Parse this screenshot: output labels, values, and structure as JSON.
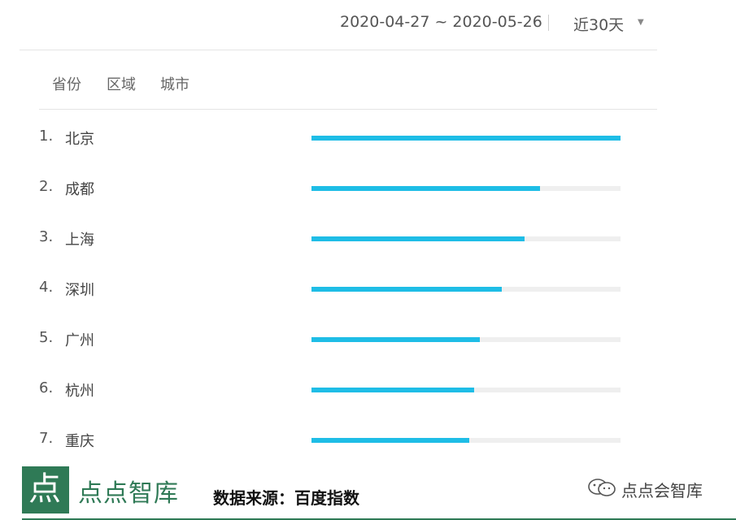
{
  "header": {
    "date_range": "2020-04-27 ~ 2020-05-26",
    "period_label": "近30天"
  },
  "tabs": [
    {
      "label": "省份"
    },
    {
      "label": "区域"
    },
    {
      "label": "城市"
    }
  ],
  "ranking": [
    {
      "rank": "1.",
      "city": "北京",
      "share": 1.0
    },
    {
      "rank": "2.",
      "city": "成都",
      "share": 0.74
    },
    {
      "rank": "3.",
      "city": "上海",
      "share": 0.69
    },
    {
      "rank": "4.",
      "city": "深圳",
      "share": 0.615
    },
    {
      "rank": "5.",
      "city": "广州",
      "share": 0.545
    },
    {
      "rank": "6.",
      "city": "杭州",
      "share": 0.525
    },
    {
      "rank": "7.",
      "city": "重庆",
      "share": 0.51
    }
  ],
  "footer": {
    "logo_glyph": "点",
    "brand": "点点智库",
    "source": "数据来源：百度指数",
    "wechat_name": "点点会智库"
  },
  "colors": {
    "bar_fill": "#1ebde6",
    "bar_track": "#efefef",
    "brand_green": "#2f7a56"
  }
}
